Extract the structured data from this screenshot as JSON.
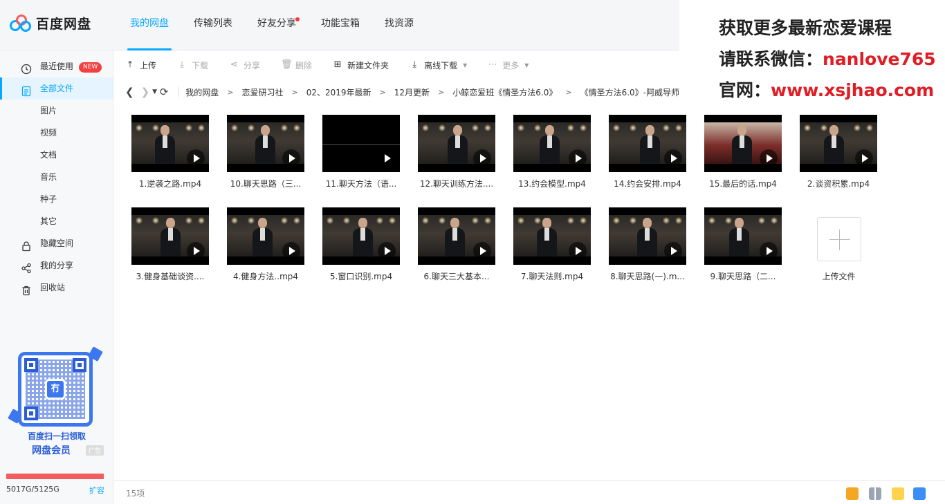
{
  "app": {
    "title": "百度网盘"
  },
  "nav_tabs": [
    {
      "label": "我的网盘",
      "active": true
    },
    {
      "label": "传输列表"
    },
    {
      "label": "好友分享",
      "dot": true
    },
    {
      "label": "功能宝箱"
    },
    {
      "label": "找资源"
    }
  ],
  "promo": {
    "line1": "获取更多最新恋爱课程",
    "line2_prefix": "请联系微信：",
    "line2_value": "nanlove765",
    "line3_prefix": "官网：",
    "line3_value": "www.xsjhao.com"
  },
  "sidebar": {
    "items": [
      {
        "label": "最近使用",
        "icon": "clock-icon",
        "badge": "NEW"
      },
      {
        "label": "全部文件",
        "icon": "file-icon",
        "active": true
      },
      {
        "label": "图片"
      },
      {
        "label": "视频"
      },
      {
        "label": "文档"
      },
      {
        "label": "音乐"
      },
      {
        "label": "种子"
      },
      {
        "label": "其它"
      },
      {
        "label": "隐藏空间",
        "icon": "lock-icon"
      },
      {
        "label": "我的分享",
        "icon": "share-icon"
      },
      {
        "label": "回收站",
        "icon": "trash-icon"
      }
    ],
    "ad": {
      "qr_center": "冇",
      "line1": "百度扫一扫领取",
      "line2": "网盘会员",
      "tag": "广告"
    },
    "quota": {
      "text": "5017G/5125G",
      "expand": "扩容",
      "used_fraction": 0.979
    }
  },
  "toolbar": {
    "upload": "上传",
    "download": "下载",
    "share": "分享",
    "delete": "删除",
    "new_folder": "新建文件夹",
    "offline_download": "离线下载",
    "more": "更多"
  },
  "breadcrumb": [
    "我的网盘",
    "恋爱研习社",
    "02、2019年最新",
    "12月更新",
    "小鲸恋爱班《情圣方法6.0》",
    "《情圣方法6.0》-阿威导师"
  ],
  "files": [
    {
      "name": "1.逆袭之路.mp4",
      "style": "normal"
    },
    {
      "name": "10.聊天思路（三...",
      "style": "normal"
    },
    {
      "name": "11.聊天方法（语...",
      "style": "dark"
    },
    {
      "name": "12.聊天训练方法....",
      "style": "normal"
    },
    {
      "name": "13.约会模型.mp4",
      "style": "normal"
    },
    {
      "name": "14.约会安排.mp4",
      "style": "normal"
    },
    {
      "name": "15.最后的话.mp4",
      "style": "red"
    },
    {
      "name": "2.谈资积累.mp4",
      "style": "normal"
    },
    {
      "name": "3.健身基础谈资....",
      "style": "normal"
    },
    {
      "name": "4.健身方法..mp4",
      "style": "normal"
    },
    {
      "name": "5.窗口识别.mp4",
      "style": "normal"
    },
    {
      "name": "6.聊天三大基本...",
      "style": "normal"
    },
    {
      "name": "7.聊天法则.mp4",
      "style": "normal"
    },
    {
      "name": "8.聊天思路(一).m...",
      "style": "normal"
    },
    {
      "name": "9.聊天思路（二...",
      "style": "normal"
    }
  ],
  "upload_tile": {
    "label": "上传文件"
  },
  "footer": {
    "count": "15项"
  },
  "colors": {
    "accent": "#06a7ff",
    "quota": "#f25d5d",
    "promo_red": "#e01c24"
  }
}
